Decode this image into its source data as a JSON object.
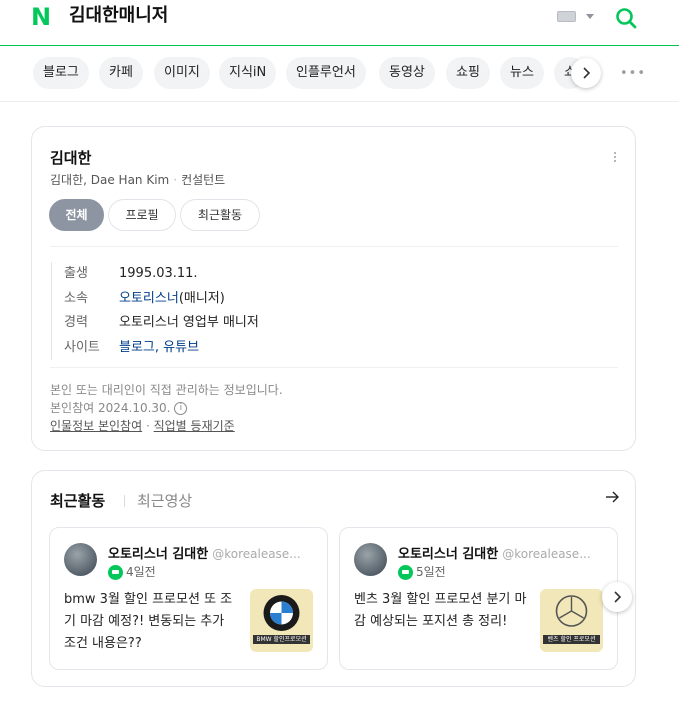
{
  "header": {
    "logo": "N",
    "query": "김대한매니저",
    "keyboard_icon": "keyboard-icon",
    "search_icon": "search-icon",
    "brand_color": "#03c75a"
  },
  "tabs": {
    "items": [
      "블로그",
      "카페",
      "이미지",
      "지식iN",
      "인플루언서",
      "동영상",
      "쇼핑",
      "뉴스",
      "쇼"
    ],
    "more_label": "•••"
  },
  "profile": {
    "name": "김대한",
    "alias": "김대한, Dae Han Kim",
    "occupation": "컨설턴트",
    "tabs": [
      "전체",
      "프로필",
      "최근활동"
    ],
    "info": [
      {
        "key": "출생",
        "value": "1995.03.11."
      },
      {
        "key": "소속",
        "value": "오토리스너",
        "suffix": "(매니저)"
      },
      {
        "key": "경력",
        "value": "오토리스너 영업부 매니저"
      },
      {
        "key": "사이트",
        "links": [
          "블로그",
          "유튜브"
        ]
      }
    ],
    "notice": "본인 또는 대리인이 직접 관리하는 정보입니다.",
    "date_note": "본인참여 2024.10.30.",
    "footer_links": [
      "인물정보 본인참여",
      "직업별 등재기준"
    ]
  },
  "activity": {
    "tab_active": "최근활동",
    "tab_other": "최근영상",
    "posts": [
      {
        "author": "오토리스너 김대한",
        "handle": "@korealease...",
        "time": "4일전",
        "text": "bmw 3월 할인 프로모션 또 조기 마감 예정?! 변동되는 추가 조건 내용은??",
        "thumb_caption": "BMW 할인프로모션"
      },
      {
        "author": "오토리스너 김대한",
        "handle": "@korealease...",
        "time": "5일전",
        "text": "벤츠 3월 할인 프로모션 분기 마감 예상되는 포지션 총 정리!",
        "thumb_caption": "벤츠 할인 프로모션"
      }
    ]
  }
}
